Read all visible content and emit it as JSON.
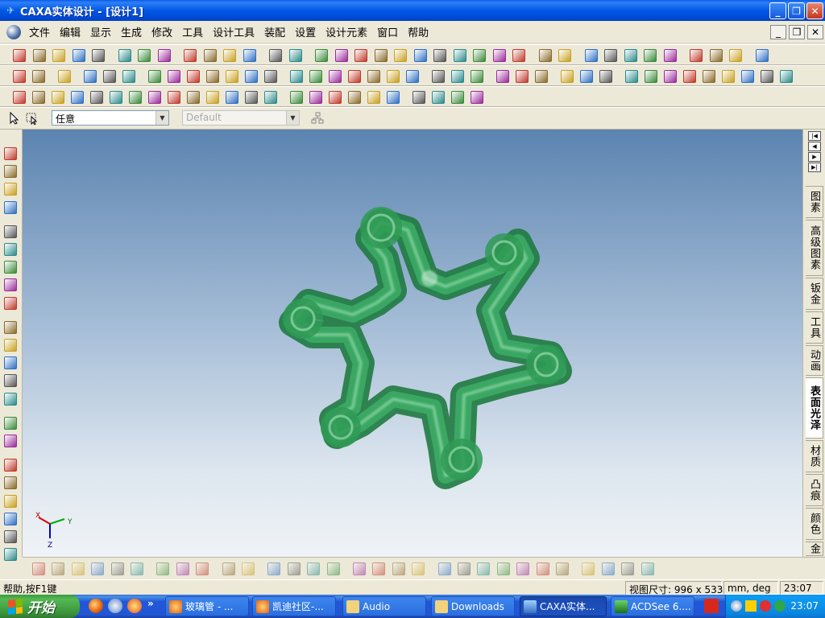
{
  "window": {
    "title": "CAXA实体设计 - [设计1]",
    "buttons": {
      "minimize": "_",
      "restore": "❐",
      "close": "✕"
    }
  },
  "menubar": {
    "items": [
      "文件",
      "编辑",
      "显示",
      "生成",
      "修改",
      "工具",
      "设计工具",
      "装配",
      "设置",
      "设计元素",
      "窗口",
      "帮助"
    ],
    "mdi_buttons": {
      "minimize": "_",
      "restore": "❐",
      "close": "✕"
    }
  },
  "toolbar_row4": {
    "selection_filter": "任意",
    "style_select": "Default"
  },
  "viewport": {
    "axis_labels": {
      "x": "X",
      "y": "Y",
      "z": "Z"
    }
  },
  "right_tabs": [
    "图素",
    "高级图素",
    "钣金",
    "工具",
    "动画",
    "表面光泽",
    "材质",
    "凸痕",
    "颜色",
    "金"
  ],
  "right_tab_active": "表面光泽",
  "statusbar": {
    "help": "帮助,按F1键",
    "view_size": "视图尺寸: 996 x 533",
    "units": "mm, deg",
    "time": "23:07"
  },
  "taskbar": {
    "start_label": "开始",
    "quicklaunch_more": "»",
    "tasks": [
      {
        "label": "玻璃管 - ...",
        "active": false
      },
      {
        "label": "凯迪社区-...",
        "active": false
      },
      {
        "label": "Audio",
        "active": false
      },
      {
        "label": "Downloads",
        "active": false
      },
      {
        "label": "CAXA实体...",
        "active": true
      },
      {
        "label": "ACDSee 6....",
        "active": false
      }
    ],
    "clock": "23:07"
  },
  "colors": {
    "titlebar": "#0058e6",
    "viewport_top": "#5c84b0",
    "viewport_bottom": "#f0f3f6",
    "model_green": "#2f9a55",
    "start_green": "#3a933a"
  }
}
